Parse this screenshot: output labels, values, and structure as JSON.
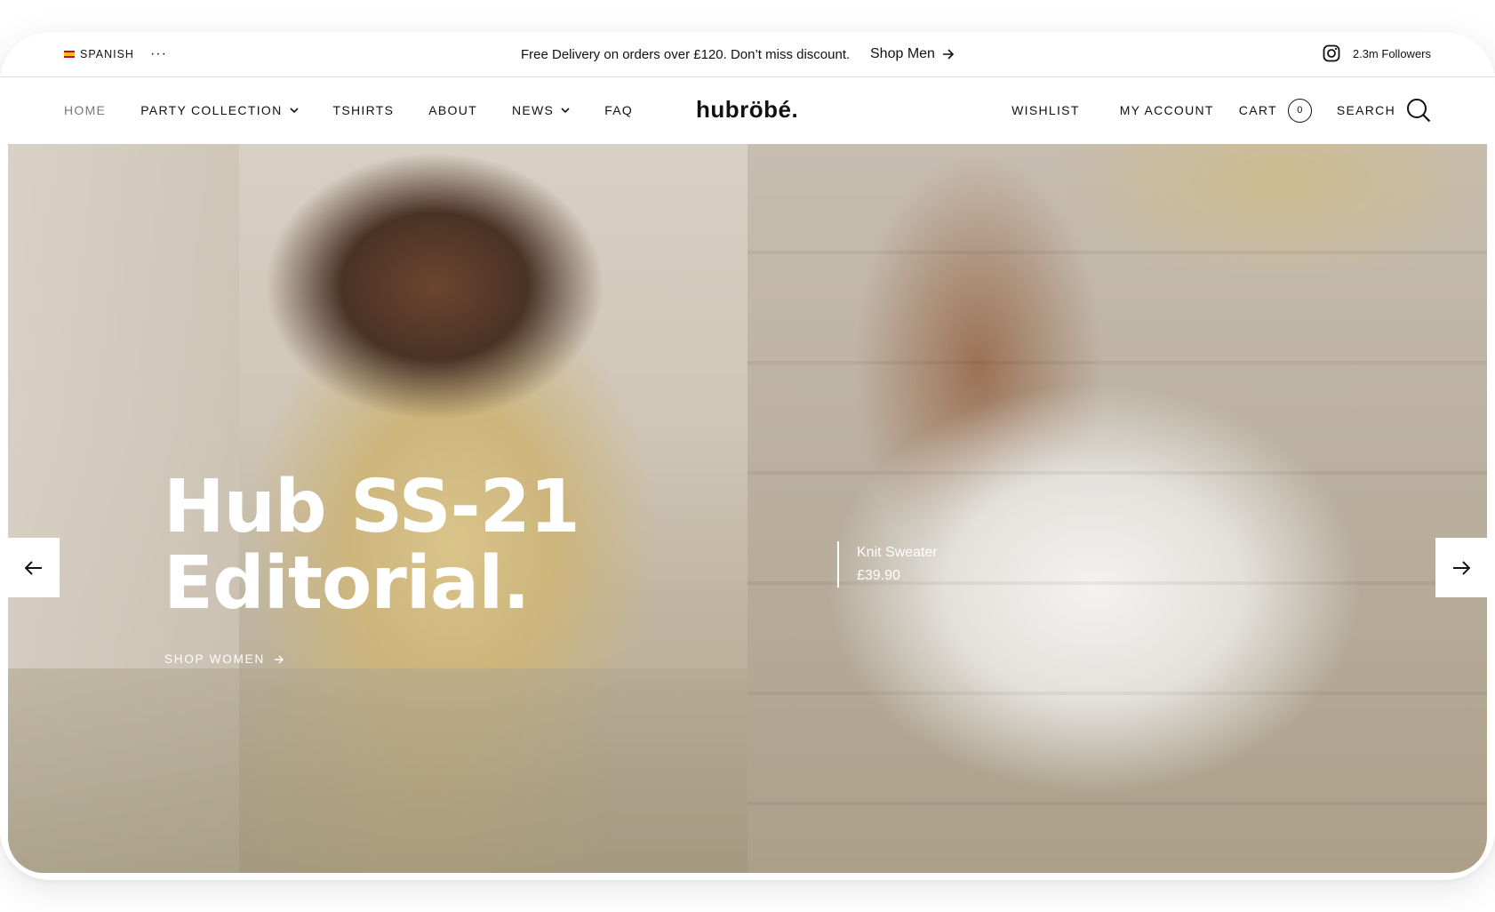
{
  "topbar": {
    "language": "SPANISH",
    "more": "···",
    "promo": "Free Delivery on orders over £120. Don’t miss discount.",
    "shop_men": "Shop Men",
    "followers": "2.3m Followers",
    "social_icon": "instagram-icon"
  },
  "nav": {
    "items": [
      {
        "label": "HOME",
        "active": true
      },
      {
        "label": "PARTY COLLECTION",
        "dropdown": true
      },
      {
        "label": "TSHIRTS"
      },
      {
        "label": "ABOUT"
      },
      {
        "label": "NEWS",
        "dropdown": true
      },
      {
        "label": "FAQ"
      }
    ],
    "logo": "hubröbé.",
    "wishlist": "WISHLIST",
    "account": "MY ACCOUNT",
    "cart": "CART",
    "cart_count": "0",
    "search": "SEARCH"
  },
  "hero": {
    "headline_line1": "Hub SS-21",
    "headline_line2": "Editorial.",
    "cta": "SHOP WOMEN",
    "product_name": "Knit Sweater",
    "product_price": "£39.90"
  },
  "colors": {
    "text": "#111111",
    "muted": "#777777",
    "divider": "#dcdcdc"
  }
}
